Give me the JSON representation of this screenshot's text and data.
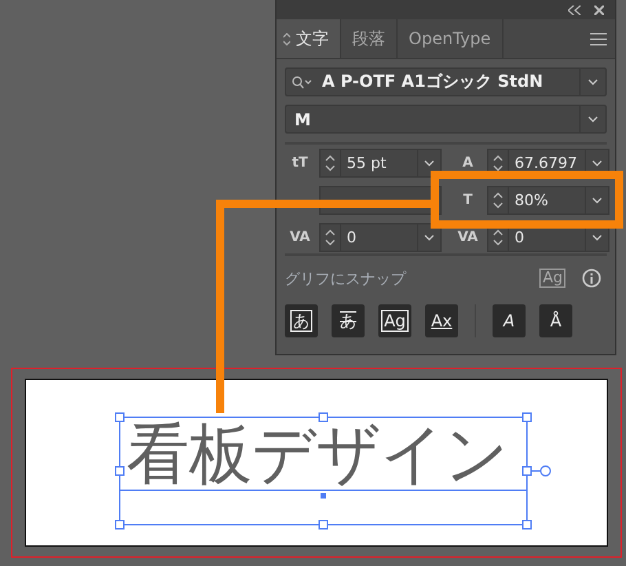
{
  "panel": {
    "tabs": [
      {
        "label": "文字",
        "selected": true
      },
      {
        "label": "段落",
        "selected": false
      },
      {
        "label": "OpenType",
        "selected": false
      }
    ],
    "font_family": {
      "value": "A P-OTF A1ゴシック StdN"
    },
    "font_style": {
      "value": "M"
    },
    "fields": [
      {
        "icon": "tT",
        "value": "55 pt"
      },
      {
        "icon": "A",
        "value": "67.6797"
      },
      {
        "kind": "covered"
      },
      {
        "icon": "T",
        "value": "80%"
      },
      {
        "icon": "VA",
        "value": "0"
      },
      {
        "icon": "VA",
        "value": "0"
      }
    ],
    "snap_label": "グリフにスナップ",
    "snap_icon": "Ag",
    "glyph_buttons": [
      {
        "label": "あ",
        "kind": "frame"
      },
      {
        "label": "あ",
        "kind": "strike"
      },
      {
        "label": "Ag",
        "kind": "frame"
      },
      {
        "label": "Ax",
        "kind": "underline"
      },
      {
        "label": "A",
        "kind": "slant"
      },
      {
        "label": "Å",
        "kind": "plain"
      }
    ]
  },
  "canvas": {
    "text": "看板デザイン"
  }
}
